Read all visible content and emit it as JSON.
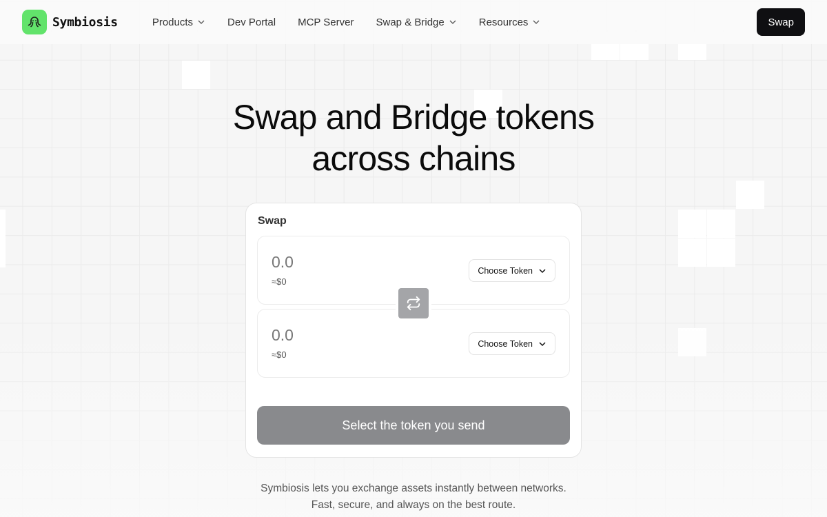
{
  "brand": {
    "name": "Symbiosis",
    "color": "#62e36b"
  },
  "nav": {
    "items": [
      {
        "label": "Products",
        "dropdown": true
      },
      {
        "label": "Dev Portal",
        "dropdown": false
      },
      {
        "label": "MCP Server",
        "dropdown": false
      },
      {
        "label": "Swap & Bridge",
        "dropdown": true
      },
      {
        "label": "Resources",
        "dropdown": true
      }
    ],
    "cta_label": "Swap"
  },
  "hero": {
    "title_line1": "Swap and Bridge tokens",
    "title_line2": "across chains"
  },
  "swap_card": {
    "title": "Swap",
    "from": {
      "placeholder": "0.0",
      "usd_value": "≈$0",
      "token_label": "Choose Token"
    },
    "to": {
      "placeholder": "0.0",
      "usd_value": "≈$0",
      "token_label": "Choose Token"
    },
    "submit_label": "Select the token you send"
  },
  "tagline": {
    "line1": "Symbiosis lets you exchange assets instantly between networks.",
    "line2": "Fast, secure, and always on the best route."
  }
}
